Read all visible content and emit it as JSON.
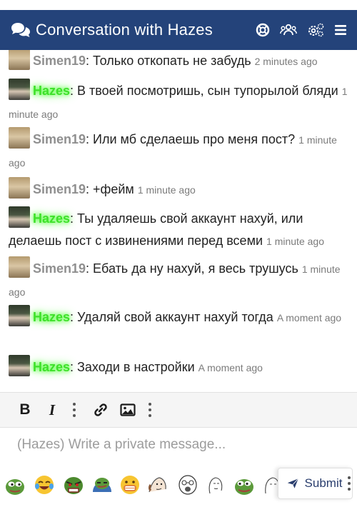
{
  "header": {
    "title": "Conversation with Hazes",
    "icons": [
      "comments-icon",
      "help-lifering-icon",
      "members-icon",
      "settings-icon",
      "menu-icon"
    ],
    "bg_color": "#24437a"
  },
  "messages": [
    {
      "user": "Simen19",
      "text": ": Только откопать не забудь",
      "time": "2 minutes ago"
    },
    {
      "user": "Hazes",
      "text": ": В твоей посмотришь, сын тупорылой бляди",
      "time": "1 minute ago"
    },
    {
      "user": "Simen19",
      "text": ": Или мб сделаешь про меня пост?",
      "time": "1 minute ago"
    },
    {
      "user": "Simen19",
      "text": ": +фейм",
      "time": "1 minute ago"
    },
    {
      "user": "Hazes",
      "text": ": Ты удаляешь свой аккаунт нахуй, или делаешь пост с извинениями перед всеми",
      "time": "1 minute ago"
    },
    {
      "user": "Simen19",
      "text": ": Ебать да ну нахуй, я весь трушусь",
      "time": "1 minute ago"
    },
    {
      "user": "Hazes",
      "text": ": Удаляй свой аккаунт нахуй тогда",
      "time": "A moment ago"
    },
    {
      "user": "Hazes",
      "text": ": Заходи в настройки",
      "time": "A moment ago"
    }
  ],
  "toolbar": {
    "bold": "B",
    "italic": "I"
  },
  "composer": {
    "placeholder": "(Hazes) Write a private message..."
  },
  "emojis": [
    "pepe-icon",
    "crying-laughing-icon",
    "pepe-angry-icon",
    "pepe-smug-icon",
    "grimacing-icon",
    "wojak-icon",
    "soyjak-icon",
    "wojak-sketch-icon",
    "pepe-icon",
    "wojak-face-icon"
  ],
  "submit_label": "Submit",
  "colors": {
    "simen": "#8f8f8f",
    "hazes": "#3ee12a",
    "accent": "#24437a"
  }
}
